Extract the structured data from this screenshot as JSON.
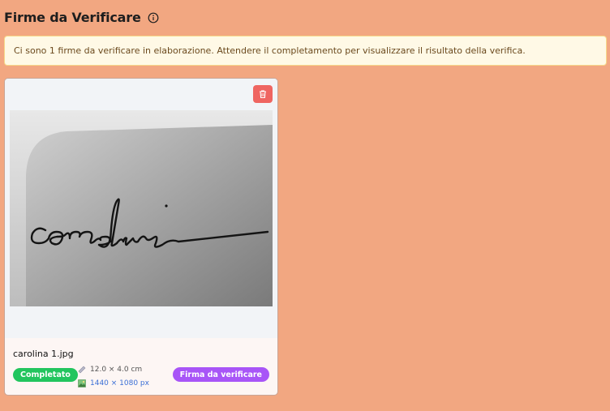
{
  "header": {
    "title": "Firme da Verificare",
    "info_icon": "info-circle-icon"
  },
  "alert": {
    "message": "Ci sono 1 firme da verificare in elaborazione. Attendere il completamento per visualizzare il risultato della verifica."
  },
  "card": {
    "delete_icon": "trash-icon",
    "image_text": "carolina",
    "file_name": "carolina 1.jpg",
    "status": "Completato",
    "dimensions": "12.0 × 4.0 cm",
    "resolution": "1440 × 1080 px",
    "dimensions_icon": "ruler-icon",
    "resolution_icon": "image-icon",
    "type_badge": "Firma da verificare"
  },
  "colors": {
    "background": "#f2a781",
    "alert_bg": "#fff9e6",
    "status_green": "#22c55e",
    "badge_purple": "#a855f7",
    "delete_red": "#ef6561",
    "link_blue": "#3b6fd6"
  }
}
